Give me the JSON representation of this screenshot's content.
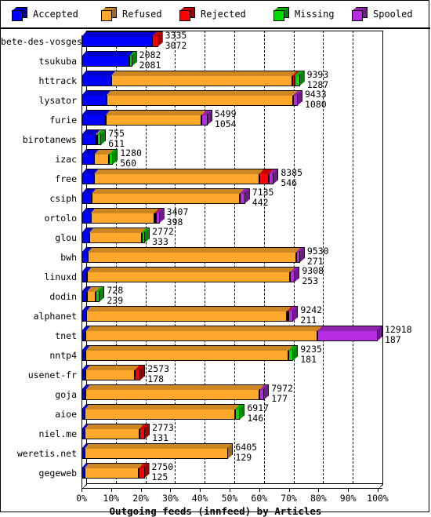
{
  "legend": {
    "items": [
      {
        "label": "Accepted",
        "color": "#0000ff",
        "key": "accepted"
      },
      {
        "label": "Refused",
        "color": "#ffa82b",
        "key": "refused"
      },
      {
        "label": "Rejected",
        "color": "#fe0000",
        "key": "rejected"
      },
      {
        "label": "Missing",
        "color": "#00dd00",
        "key": "missing"
      },
      {
        "label": "Spooled",
        "color": "#b62ce0",
        "key": "spooled"
      }
    ]
  },
  "axis": {
    "x_title": "Outgoing feeds (innfeed) by Articles",
    "x_ticks": [
      "0%",
      "10%",
      "20%",
      "30%",
      "40%",
      "50%",
      "60%",
      "70%",
      "80%",
      "90%",
      "100%"
    ],
    "x_min": 0,
    "x_max": 100
  },
  "chart_data": {
    "type": "bar",
    "orientation": "horizontal",
    "title": "Outgoing feeds (innfeed) by Articles",
    "xlabel": "Outgoing feeds (innfeed) by Articles",
    "ylabel": "",
    "xlim": [
      0,
      100
    ],
    "grid": true,
    "legend_position": "top",
    "value_scale_max": 12918,
    "series_names": [
      "Accepted",
      "Refused",
      "Rejected",
      "Missing",
      "Spooled"
    ],
    "categories": [
      "bete-des-vosges",
      "tsukuba",
      "httrack",
      "lysator",
      "furie",
      "birotanews",
      "izac",
      "free",
      "csiph",
      "ortolo",
      "glou",
      "bwh",
      "linuxd",
      "dodin",
      "alphanet",
      "tnet",
      "nntp4",
      "usenet-fr",
      "goja",
      "aioe",
      "niel.me",
      "weretis.net",
      "gegeweb"
    ],
    "rows": [
      {
        "name": "bete-des-vosges",
        "total": 3335,
        "second": 3072,
        "segments": [
          {
            "series": "Accepted",
            "value": 3072,
            "pct": 23.78
          },
          {
            "series": "Rejected",
            "value": 263,
            "pct": 2.04
          }
        ]
      },
      {
        "name": "tsukuba",
        "total": 2082,
        "second": 2081,
        "segments": [
          {
            "series": "Accepted",
            "value": 2081,
            "pct": 16.11
          },
          {
            "series": "Missing",
            "value": 1,
            "pct": 1.0
          }
        ]
      },
      {
        "name": "httrack",
        "total": 9393,
        "second": 1287,
        "segments": [
          {
            "series": "Accepted",
            "value": 1287,
            "pct": 9.96
          },
          {
            "series": "Refused",
            "value": 7900,
            "pct": 61.15
          },
          {
            "series": "Rejected",
            "value": 100,
            "pct": 0.77
          },
          {
            "series": "Missing",
            "value": 106,
            "pct": 1.82
          }
        ]
      },
      {
        "name": "lysator",
        "total": 9433,
        "second": 1080,
        "segments": [
          {
            "series": "Accepted",
            "value": 1080,
            "pct": 8.36
          },
          {
            "series": "Refused",
            "value": 8150,
            "pct": 63.09
          },
          {
            "series": "Spooled",
            "value": 203,
            "pct": 1.57
          }
        ]
      },
      {
        "name": "furie",
        "total": 5499,
        "second": 1054,
        "segments": [
          {
            "series": "Accepted",
            "value": 1054,
            "pct": 8.16
          },
          {
            "series": "Refused",
            "value": 4180,
            "pct": 32.36
          },
          {
            "series": "Spooled",
            "value": 265,
            "pct": 2.05
          }
        ]
      },
      {
        "name": "birotanews",
        "total": 755,
        "second": 611,
        "segments": [
          {
            "series": "Accepted",
            "value": 611,
            "pct": 4.73
          },
          {
            "series": "Refused",
            "value": 64,
            "pct": 0.5
          },
          {
            "series": "Missing",
            "value": 80,
            "pct": 1.45
          }
        ]
      },
      {
        "name": "izac",
        "total": 1280,
        "second": 560,
        "segments": [
          {
            "series": "Accepted",
            "value": 560,
            "pct": 4.34
          },
          {
            "series": "Refused",
            "value": 640,
            "pct": 4.95
          },
          {
            "series": "Missing",
            "value": 80,
            "pct": 1.35
          }
        ]
      },
      {
        "name": "free",
        "total": 8385,
        "second": 546,
        "segments": [
          {
            "series": "Accepted",
            "value": 546,
            "pct": 4.23
          },
          {
            "series": "Refused",
            "value": 7200,
            "pct": 55.73
          },
          {
            "series": "Rejected",
            "value": 420,
            "pct": 3.25
          },
          {
            "series": "Spooled",
            "value": 219,
            "pct": 1.69
          }
        ]
      },
      {
        "name": "csiph",
        "total": 7135,
        "second": 442,
        "segments": [
          {
            "series": "Accepted",
            "value": 442,
            "pct": 3.42
          },
          {
            "series": "Refused",
            "value": 6450,
            "pct": 49.93
          },
          {
            "series": "Spooled",
            "value": 243,
            "pct": 1.88
          }
        ]
      },
      {
        "name": "ortolo",
        "total": 3407,
        "second": 398,
        "segments": [
          {
            "series": "Accepted",
            "value": 398,
            "pct": 3.08
          },
          {
            "series": "Refused",
            "value": 2780,
            "pct": 21.52
          },
          {
            "series": "Rejected",
            "value": 60,
            "pct": 0.46
          },
          {
            "series": "Spooled",
            "value": 169,
            "pct": 1.31
          }
        ]
      },
      {
        "name": "glou",
        "total": 2772,
        "second": 333,
        "segments": [
          {
            "series": "Accepted",
            "value": 333,
            "pct": 2.58
          },
          {
            "series": "Refused",
            "value": 2290,
            "pct": 17.73
          },
          {
            "series": "Missing",
            "value": 149,
            "pct": 1.15
          }
        ]
      },
      {
        "name": "bwh",
        "total": 9530,
        "second": 271,
        "segments": [
          {
            "series": "Accepted",
            "value": 271,
            "pct": 2.1
          },
          {
            "series": "Refused",
            "value": 9080,
            "pct": 70.29
          },
          {
            "series": "Spooled",
            "value": 179,
            "pct": 1.39
          }
        ]
      },
      {
        "name": "linuxd",
        "total": 9308,
        "second": 253,
        "segments": [
          {
            "series": "Accepted",
            "value": 253,
            "pct": 1.96
          },
          {
            "series": "Refused",
            "value": 8850,
            "pct": 68.51
          },
          {
            "series": "Spooled",
            "value": 205,
            "pct": 1.59
          }
        ]
      },
      {
        "name": "dodin",
        "total": 728,
        "second": 239,
        "segments": [
          {
            "series": "Accepted",
            "value": 239,
            "pct": 1.85
          },
          {
            "series": "Refused",
            "value": 389,
            "pct": 3.01
          },
          {
            "series": "Missing",
            "value": 100,
            "pct": 1.32
          }
        ]
      },
      {
        "name": "alphanet",
        "total": 9242,
        "second": 211,
        "segments": [
          {
            "series": "Accepted",
            "value": 211,
            "pct": 1.63
          },
          {
            "series": "Refused",
            "value": 8750,
            "pct": 67.74
          },
          {
            "series": "Rejected",
            "value": 60,
            "pct": 0.46
          },
          {
            "series": "Spooled",
            "value": 221,
            "pct": 1.71
          }
        ]
      },
      {
        "name": "tnet",
        "total": 12918,
        "second": 187,
        "segments": [
          {
            "series": "Accepted",
            "value": 187,
            "pct": 1.45
          },
          {
            "series": "Refused",
            "value": 10100,
            "pct": 78.18
          },
          {
            "series": "Spooled",
            "value": 2631,
            "pct": 20.37
          }
        ]
      },
      {
        "name": "nntp4",
        "total": 9235,
        "second": 181,
        "segments": [
          {
            "series": "Accepted",
            "value": 181,
            "pct": 1.4
          },
          {
            "series": "Refused",
            "value": 8840,
            "pct": 68.43
          },
          {
            "series": "Missing",
            "value": 214,
            "pct": 1.66
          }
        ]
      },
      {
        "name": "usenet-fr",
        "total": 2573,
        "second": 178,
        "segments": [
          {
            "series": "Accepted",
            "value": 178,
            "pct": 1.38
          },
          {
            "series": "Refused",
            "value": 2145,
            "pct": 16.6
          },
          {
            "series": "Rejected",
            "value": 250,
            "pct": 1.94
          }
        ]
      },
      {
        "name": "goja",
        "total": 7972,
        "second": 177,
        "segments": [
          {
            "series": "Accepted",
            "value": 177,
            "pct": 1.37
          },
          {
            "series": "Refused",
            "value": 7595,
            "pct": 58.79
          },
          {
            "series": "Spooled",
            "value": 200,
            "pct": 1.55
          }
        ]
      },
      {
        "name": "aioe",
        "total": 6917,
        "second": 146,
        "segments": [
          {
            "series": "Accepted",
            "value": 146,
            "pct": 1.13
          },
          {
            "series": "Refused",
            "value": 6551,
            "pct": 50.71
          },
          {
            "series": "Missing",
            "value": 220,
            "pct": 1.7
          }
        ]
      },
      {
        "name": "niel.me",
        "total": 2773,
        "second": 131,
        "segments": [
          {
            "series": "Accepted",
            "value": 131,
            "pct": 1.01
          },
          {
            "series": "Refused",
            "value": 2392,
            "pct": 18.52
          },
          {
            "series": "Rejected",
            "value": 250,
            "pct": 1.94
          }
        ]
      },
      {
        "name": "weretis.net",
        "total": 6405,
        "second": 129,
        "segments": [
          {
            "series": "Accepted",
            "value": 129,
            "pct": 1.0
          },
          {
            "series": "Refused",
            "value": 6276,
            "pct": 48.58
          }
        ]
      },
      {
        "name": "gegeweb",
        "total": 2750,
        "second": 125,
        "segments": [
          {
            "series": "Accepted",
            "value": 125,
            "pct": 0.97
          },
          {
            "series": "Refused",
            "value": 2375,
            "pct": 18.39
          },
          {
            "series": "Rejected",
            "value": 250,
            "pct": 1.94
          }
        ]
      }
    ]
  }
}
